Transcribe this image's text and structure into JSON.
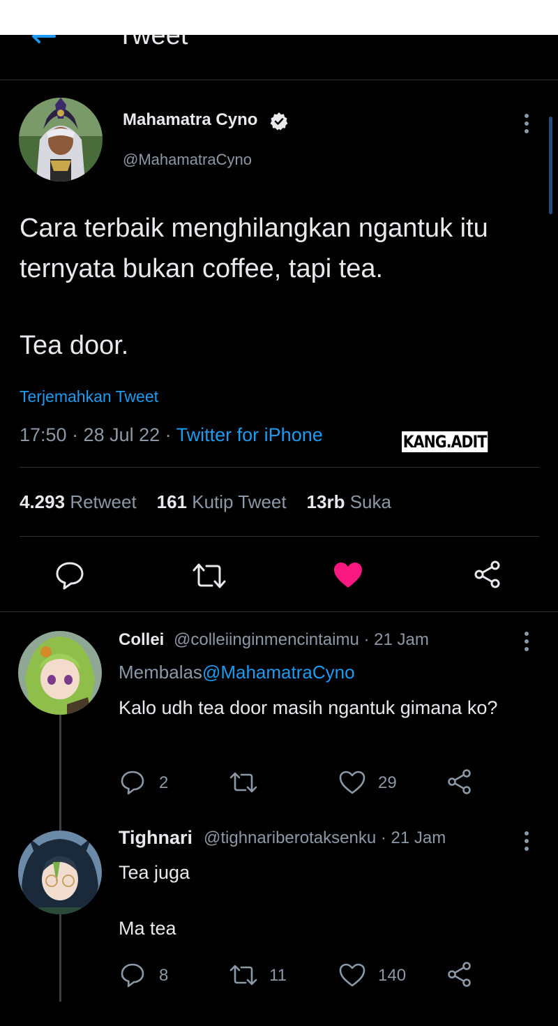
{
  "header": {
    "title": "Tweet"
  },
  "tweet": {
    "author_name": "Mahamatra Cyno",
    "author_handle": "@MahamatraCyno",
    "text_line1": "Cara terbaik menghilangkan ngantuk itu ternyata bukan coffee, tapi tea.",
    "text_line2": "Tea door.",
    "translate_label": "Terjemahkan Tweet",
    "time": "17:50 · 28 Jul 22 · ",
    "source": "Twitter for iPhone",
    "watermark": "KANG.ADIT",
    "stats": {
      "retweets_count": "4.293",
      "retweets_label": "Retweet",
      "quotes_count": "161",
      "quotes_label": "Kutip Tweet",
      "likes_count": "13rb",
      "likes_label": "Suka"
    },
    "liked": true
  },
  "replies": [
    {
      "name": "Collei",
      "handle": "@colleiinginmencintaimu · 21 Jam",
      "replying_prefix": "Membalas",
      "replying_to": "@MahamatraCyno",
      "text": "Kalo udh tea door masih ngantuk gimana ko?",
      "reply_count": "2",
      "retweet_count": "",
      "like_count": "29"
    },
    {
      "name": "Tighnari",
      "handle": "@tighnariberotaksenku · 21 Jam",
      "text_line1": "Tea juga",
      "text_line2": "Ma tea",
      "reply_count": "8",
      "retweet_count": "11",
      "like_count": "140"
    }
  ],
  "colors": {
    "accent": "#1d9bf0",
    "like": "#f91880",
    "background": "#000000",
    "muted": "#8b98a5"
  },
  "icons": [
    "back-arrow-icon",
    "verified-badge-icon",
    "more-icon",
    "reply-icon",
    "retweet-icon",
    "like-icon",
    "share-icon"
  ]
}
